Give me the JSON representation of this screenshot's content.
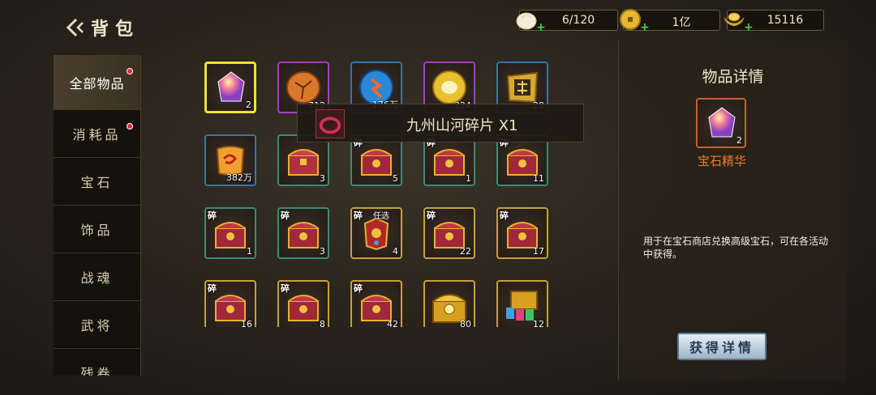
{
  "header": {
    "title": "背包",
    "resources": [
      {
        "icon": "bun-icon",
        "value": "6/120"
      },
      {
        "icon": "coin-icon",
        "value": "1亿"
      },
      {
        "icon": "ingot-icon",
        "value": "15116"
      }
    ]
  },
  "sidebar": {
    "tabs": [
      {
        "label": "全部物品",
        "badge": true,
        "active": true
      },
      {
        "label": "消耗品",
        "badge": true
      },
      {
        "label": "宝石"
      },
      {
        "label": "饰品"
      },
      {
        "label": "战魂"
      },
      {
        "label": "武将"
      },
      {
        "label": "残卷"
      }
    ]
  },
  "grid": {
    "items": [
      {
        "icon": "gem-essence-icon",
        "count": "2",
        "frame": "selected"
      },
      {
        "icon": "orange-stone-icon",
        "count": "712",
        "frame": "purple"
      },
      {
        "icon": "blue-stone-icon",
        "count": "176万",
        "frame": "blue"
      },
      {
        "icon": "gold-token-icon",
        "count": "324",
        "frame": "purple"
      },
      {
        "icon": "hong-token-icon",
        "count": "28",
        "frame": "blue"
      },
      {
        "icon": "scroll-icon",
        "count": "382万",
        "frame": "blue"
      },
      {
        "icon": "chest-icon",
        "count": "3",
        "frame": "teal"
      },
      {
        "icon": "chest-fragment-icon",
        "tag": "碎",
        "count": "5",
        "frame": "teal"
      },
      {
        "icon": "chest-fragment-icon",
        "tag": "碎",
        "count": "1",
        "frame": "teal"
      },
      {
        "icon": "chest-fragment-icon",
        "tag": "碎",
        "count": "11",
        "frame": "teal"
      },
      {
        "icon": "chest-fragment-icon",
        "tag": "碎",
        "count": "1",
        "frame": "teal"
      },
      {
        "icon": "chest-fragment-icon",
        "tag": "碎",
        "count": "3",
        "frame": "teal"
      },
      {
        "icon": "armor-fragment-icon",
        "tag": "碎",
        "tag2": "任选",
        "count": "4",
        "frame": "gold"
      },
      {
        "icon": "chest-fragment-icon",
        "tag": "碎",
        "count": "22",
        "frame": "gold"
      },
      {
        "icon": "chest-fragment-icon",
        "tag": "碎",
        "count": "17",
        "frame": "gold"
      },
      {
        "icon": "chest-fragment-icon",
        "tag": "碎",
        "count": "16",
        "frame": "gold"
      },
      {
        "icon": "chest-fragment-icon",
        "tag": "碎",
        "count": "8",
        "frame": "gold"
      },
      {
        "icon": "chest-fragment-icon",
        "tag": "碎",
        "count": "42",
        "frame": "gold"
      },
      {
        "icon": "gold-chest-icon",
        "count": "80",
        "frame": "gold"
      },
      {
        "icon": "card-chest-icon",
        "count": "12",
        "frame": "gold"
      }
    ]
  },
  "tooltip": {
    "text": "九州山河碎片 X1"
  },
  "detail": {
    "title": "物品详情",
    "item_count": "2",
    "item_name": "宝石精华",
    "description": "用于在宝石商店兑换高级宝石，可在各活动中获得。",
    "button_label": "获得详情"
  },
  "colors": {
    "selected_frame": "#f0e030",
    "item_name": "#f07a2a",
    "plus": "#3cd35a",
    "badge": "#e0283a"
  }
}
